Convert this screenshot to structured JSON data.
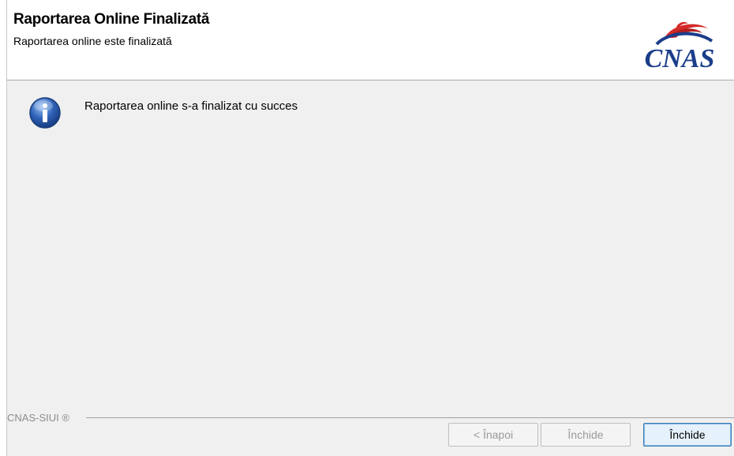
{
  "header": {
    "title": "Raportarea Online Finalizată",
    "subtitle": "Raportarea online este finalizată",
    "logo_text": "CNAS"
  },
  "content": {
    "icon": "info-icon",
    "message": "Raportarea online s-a finalizat cu succes"
  },
  "footer": {
    "brand": "CNAS-SIUI ®",
    "buttons": {
      "back_label": "< Înapoi",
      "close_disabled_label": "Închide",
      "close_label": "Închide"
    }
  },
  "colors": {
    "accent_red": "#d42a2a",
    "logo_blue": "#1b3d8a",
    "info_blue": "#2f63b8"
  }
}
